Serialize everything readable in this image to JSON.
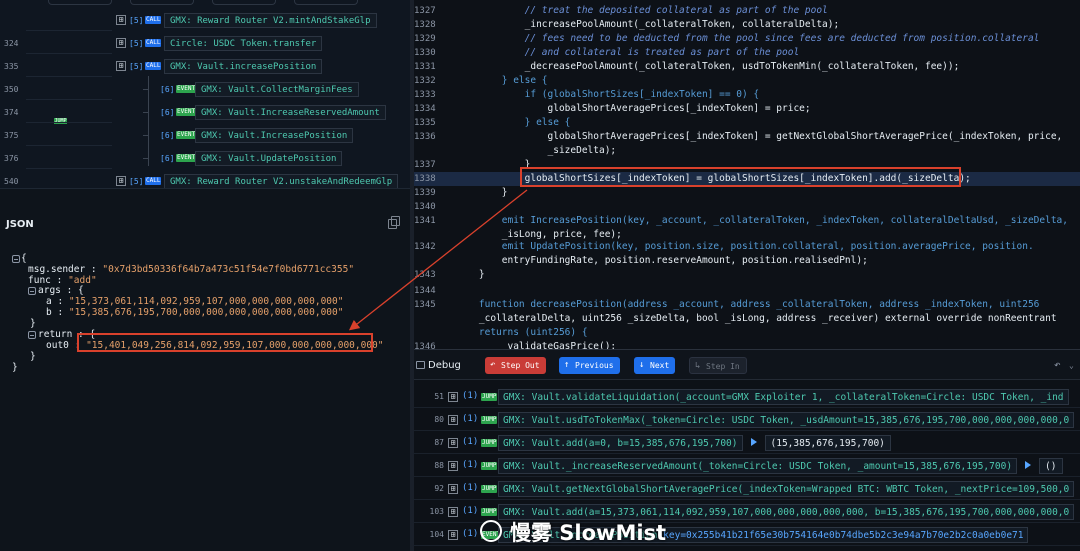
{
  "trace": {
    "rows": [
      {
        "num": "",
        "depth": "[5]",
        "tag": "CALL",
        "contract": "GMX: Reward Router V2",
        "func": ".mintAndStakeGlp"
      },
      {
        "num": "324",
        "depth": "[5]",
        "tag": "CALL",
        "contract": "Circle: USDC Token",
        "func": ".transfer"
      },
      {
        "num": "335",
        "depth": "[5]",
        "tag": "CALL",
        "contract": "GMX: Vault",
        "func": ".increasePosition"
      },
      {
        "num": "350",
        "depth": "[6]",
        "tag": "EVENT",
        "contract": "GMX: Vault",
        "func": ".CollectMarginFees"
      },
      {
        "num": "374",
        "depth": "[6]",
        "tag": "EVENT",
        "contract": "GMX: Vault",
        "func": ".IncreaseReservedAmount"
      },
      {
        "num": "375",
        "depth": "[6]",
        "tag": "EVENT",
        "contract": "GMX: Vault",
        "func": ".IncreasePosition"
      },
      {
        "num": "376",
        "depth": "[6]",
        "tag": "EVENT",
        "contract": "GMX: Vault",
        "func": ".UpdatePosition"
      },
      {
        "num": "540",
        "depth": "[5]",
        "tag": "CALL",
        "contract": "GMX: Reward Router V2",
        "func": ".unstakeAndRedeemGlp"
      }
    ],
    "jump_label": "JUMP"
  },
  "json_panel": {
    "title": "JSON",
    "open_brace": "{",
    "sender_key": "msg.sender",
    "sender_val": "\"0x7d3bd50336f64b7a473c51f54e7f0bd6771cc355\"",
    "func_key": "func",
    "func_val": "\"add\"",
    "args_key": "args",
    "a_key": "a",
    "a_val": "\"15,373,061,114,092,959,107,000,000,000,000,000\"",
    "b_key": "b",
    "b_val": "\"15,385,676,195,700,000,000,000,000,000,000,000\"",
    "close_inner": "}",
    "return_key": "return",
    "out0_key": "out0",
    "out0_val": "\"15,401,049,256,814,092,959,107,000,000,000,000,000\"",
    "close_inner2": "}",
    "close_outer": "}"
  },
  "code": {
    "lines": [
      {
        "n": "1327",
        "t": "            // treat the deposited collateral as part of the pool"
      },
      {
        "n": "1328",
        "t": "            _increasePoolAmount(_collateralToken, collateralDelta);"
      },
      {
        "n": "1329",
        "t": "            // fees need to be deducted from the pool since fees are deducted from position.collateral"
      },
      {
        "n": "1330",
        "t": "            // and collateral is treated as part of the pool"
      },
      {
        "n": "1331",
        "t": "            _decreasePoolAmount(_collateralToken, usdToTokenMin(_collateralToken, fee));"
      },
      {
        "n": "1332",
        "t": "        } else {"
      },
      {
        "n": "1333",
        "t": "            if (globalShortSizes[_indexToken] == 0) {"
      },
      {
        "n": "1334",
        "t": "                globalShortAveragePrices[_indexToken] = price;"
      },
      {
        "n": "1335",
        "t": "            } else {"
      },
      {
        "n": "1336",
        "t": "                globalShortAveragePrices[_indexToken] = getNextGlobalShortAveragePrice(_indexToken, price,"
      },
      {
        "n": "",
        "t": "                _sizeDelta);"
      },
      {
        "n": "1337",
        "t": "            }"
      },
      {
        "n": "1338",
        "t": "            globalShortSizes[_indexToken] = globalShortSizes[_indexToken].add(_sizeDelta);"
      },
      {
        "n": "1339",
        "t": "        }"
      },
      {
        "n": "1340",
        "t": ""
      },
      {
        "n": "1341",
        "t": "        emit IncreasePosition(key, _account, _collateralToken, _indexToken, collateralDeltaUsd, _sizeDelta,"
      },
      {
        "n": "",
        "t": "        _isLong, price, fee);"
      },
      {
        "n": "1342",
        "t": "        emit UpdatePosition(key, position.size, position.collateral, position.averagePrice, position."
      },
      {
        "n": "",
        "t": "        entryFundingRate, position.reserveAmount, position.realisedPnl);"
      },
      {
        "n": "1343",
        "t": "    }"
      },
      {
        "n": "1344",
        "t": ""
      },
      {
        "n": "1345",
        "t": "    function decreasePosition(address _account, address _collateralToken, address _indexToken, uint256"
      },
      {
        "n": "",
        "t": "    _collateralDelta, uint256 _sizeDelta, bool _isLong, address _receiver) external override nonReentrant"
      },
      {
        "n": "",
        "t": "    returns (uint256) {"
      },
      {
        "n": "1346",
        "t": "        _validateGasPrice();"
      }
    ]
  },
  "debug": {
    "title": "Debug",
    "buttons": {
      "step_out": "Step Out",
      "previous": "Previous",
      "next": "Next",
      "step_in": "Step In"
    },
    "rows": [
      {
        "num": "51",
        "depth": "(1)",
        "tag": "JUMP",
        "text": "GMX: Vault.validateLiquidation(_account=GMX Exploiter 1, _collateralToken=Circle: USDC Token, _ind"
      },
      {
        "num": "80",
        "depth": "(1)",
        "tag": "JUMP",
        "text": "GMX: Vault.usdToTokenMax(_token=Circle: USDC Token, _usdAmount=15,385,676,195,700,000,000,000,000,0"
      },
      {
        "num": "87",
        "depth": "(1)",
        "tag": "JUMP",
        "text": "GMX: Vault.add(a=0, b=15,385,676,195,700)",
        "ret": "(15,385,676,195,700)"
      },
      {
        "num": "88",
        "depth": "(1)",
        "tag": "JUMP",
        "text": "GMX: Vault._increaseReservedAmount(_token=Circle: USDC Token, _amount=15,385,676,195,700)",
        "ret": "()"
      },
      {
        "num": "92",
        "depth": "(1)",
        "tag": "JUMP",
        "text": "GMX: Vault.getNextGlobalShortAveragePrice(_indexToken=Wrapped BTC: WBTC Token, _nextPrice=109,500,0"
      },
      {
        "num": "103",
        "depth": "(1)",
        "tag": "JUMP",
        "text": "GMX: Vault.add(a=15,373,061,114,092,959,107,000,000,000,000,000, b=15,385,676,195,700,000,000,000,0"
      },
      {
        "num": "104",
        "depth": "(1)",
        "tag": "EVENT",
        "text": "GMX: Vault.IncreasePosition",
        "extra": "(key=0x255b41b21f65e30b754164e0b74dbe5b2c3e94a7b70e2b2c0a0eb0e71"
      }
    ]
  },
  "watermark": "慢雾 SlowMist",
  "colors": {
    "highlight": "#d9412c",
    "step_out": "#c93c37",
    "previous": "#1f6feb",
    "next": "#1f6feb",
    "step_in": "#2b3240"
  }
}
